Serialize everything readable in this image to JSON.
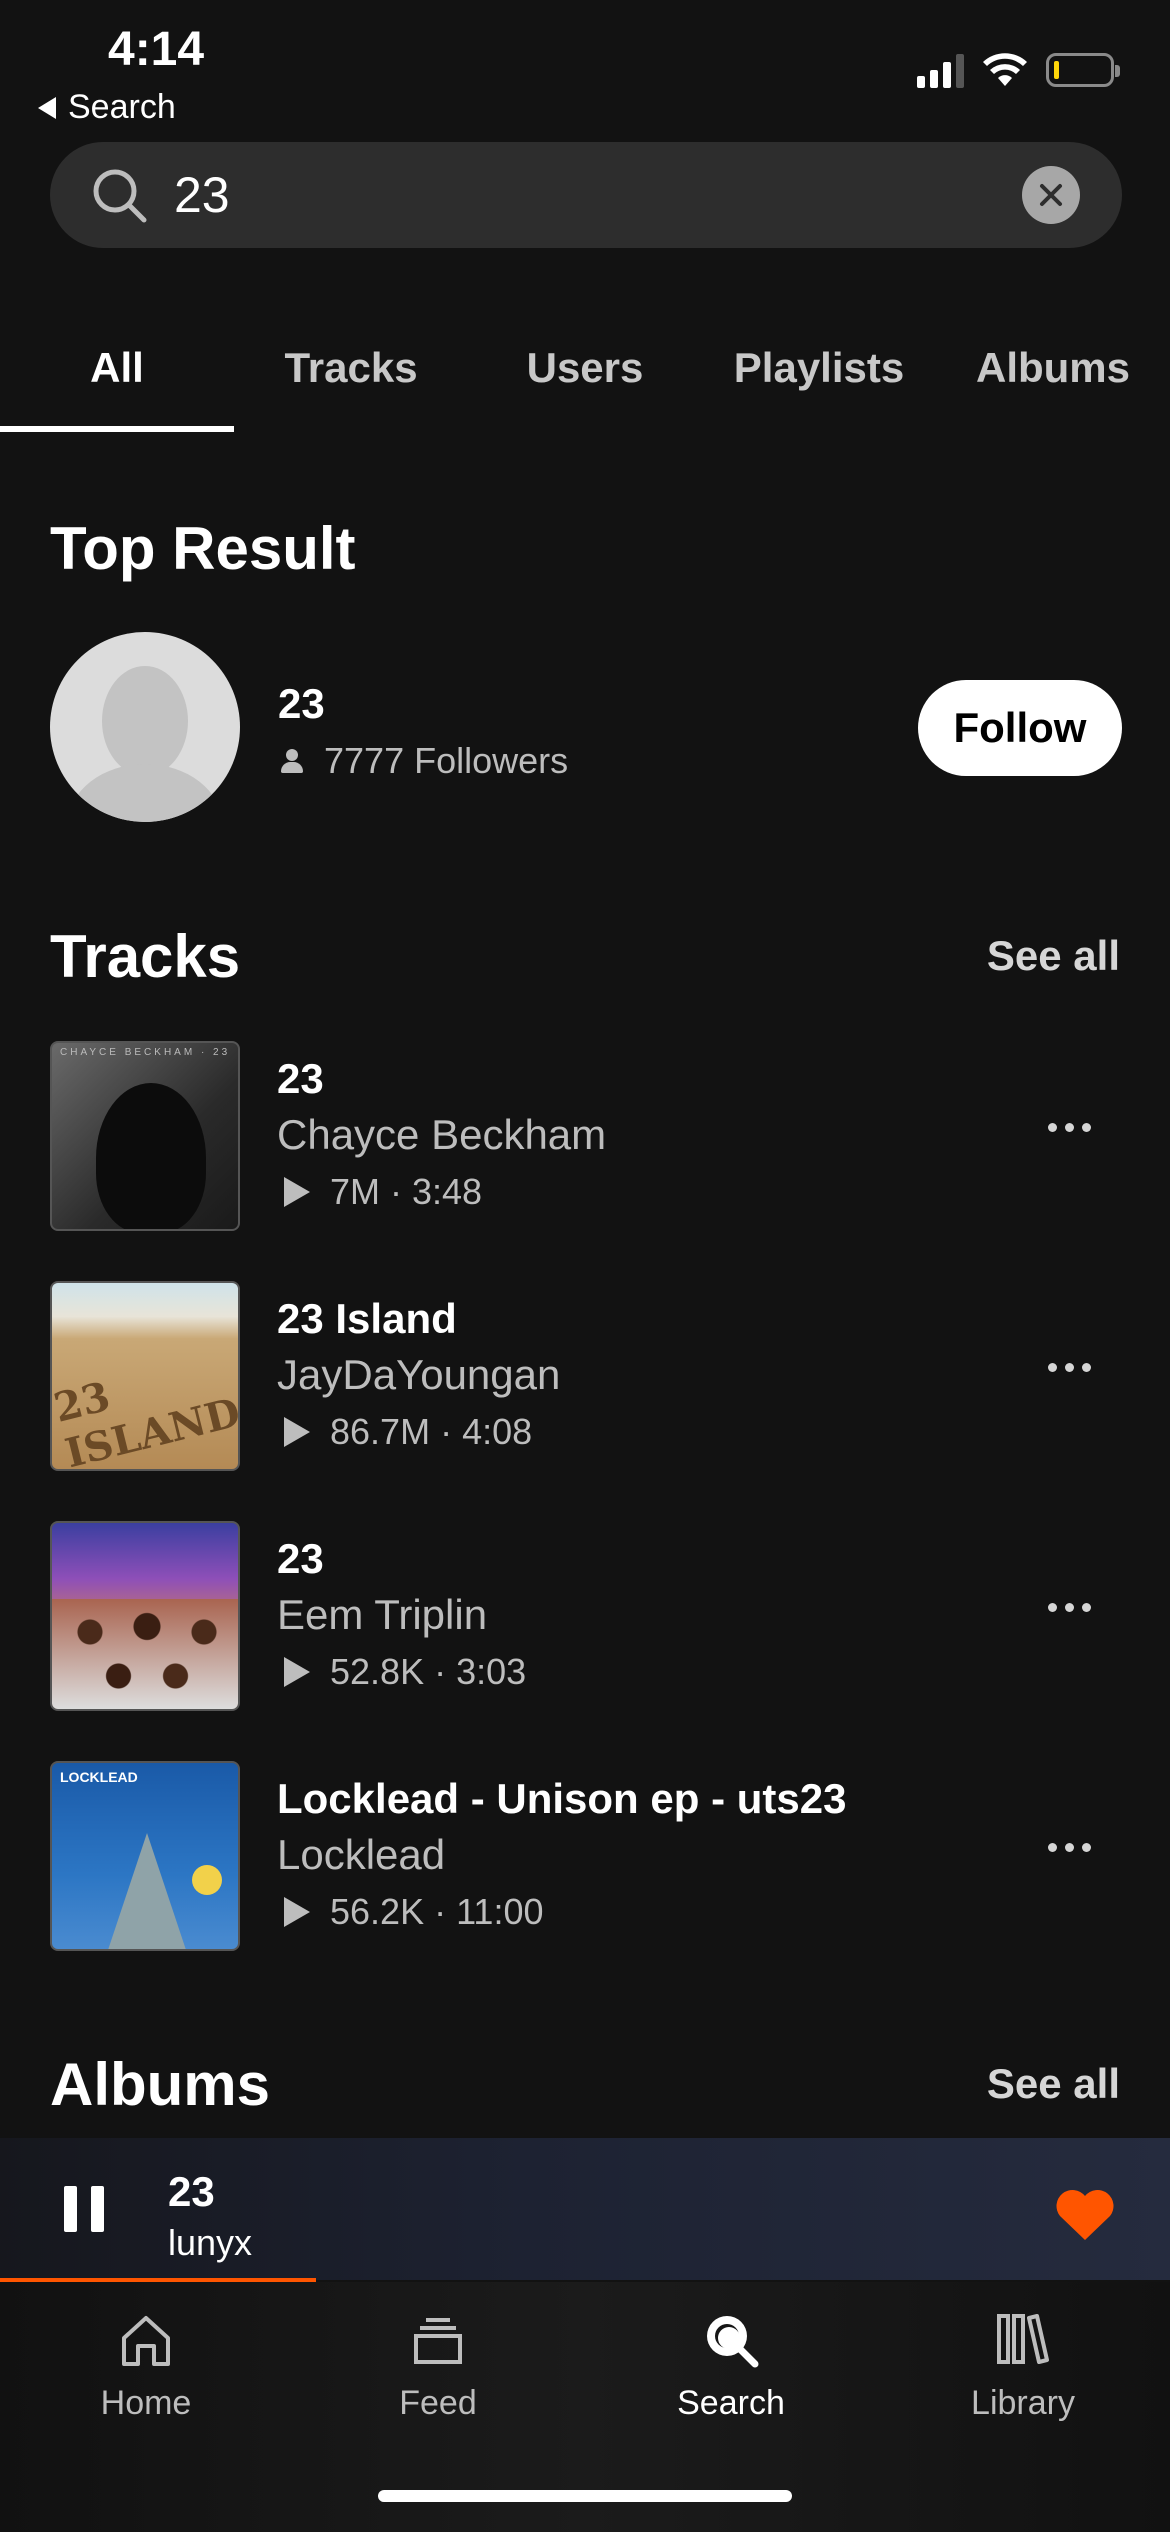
{
  "status_bar": {
    "time": "4:14",
    "back_label": "Search"
  },
  "search": {
    "value": "23",
    "placeholder": ""
  },
  "tabs": [
    {
      "label": "All",
      "active": true
    },
    {
      "label": "Tracks",
      "active": false
    },
    {
      "label": "Users",
      "active": false
    },
    {
      "label": "Playlists",
      "active": false
    },
    {
      "label": "Albums",
      "active": false
    }
  ],
  "top_result": {
    "heading": "Top Result",
    "name": "23",
    "followers": "7777 Followers",
    "follow_label": "Follow"
  },
  "tracks_section": {
    "heading": "Tracks",
    "see_all": "See all",
    "items": [
      {
        "title": "23",
        "artist": "Chayce Beckham",
        "plays": "7M",
        "duration": "3:48",
        "art_text": "CHAYCE BECKHAM · 23"
      },
      {
        "title": "23 Island",
        "artist": "JayDaYoungan",
        "plays": "86.7M",
        "duration": "4:08",
        "art_text": "23 ISLAND"
      },
      {
        "title": "23",
        "artist": "Eem Triplin",
        "plays": "52.8K",
        "duration": "3:03",
        "art_text": ""
      },
      {
        "title": "Locklead - Unison ep - uts23",
        "artist": "Locklead",
        "plays": "56.2K",
        "duration": "11:00",
        "art_text": "LOCKLEAD"
      }
    ]
  },
  "albums_section": {
    "heading": "Albums",
    "see_all": "See all"
  },
  "now_playing": {
    "title": "23",
    "artist": "lunyx",
    "progress": 0.27,
    "liked": true
  },
  "nav": [
    {
      "label": "Home",
      "icon": "home-icon",
      "active": false
    },
    {
      "label": "Feed",
      "icon": "feed-icon",
      "active": false
    },
    {
      "label": "Search",
      "icon": "search-icon",
      "active": true
    },
    {
      "label": "Library",
      "icon": "library-icon",
      "active": false
    }
  ],
  "colors": {
    "accent": "#ff5500",
    "background": "#121212",
    "heart": "#ff5500"
  }
}
